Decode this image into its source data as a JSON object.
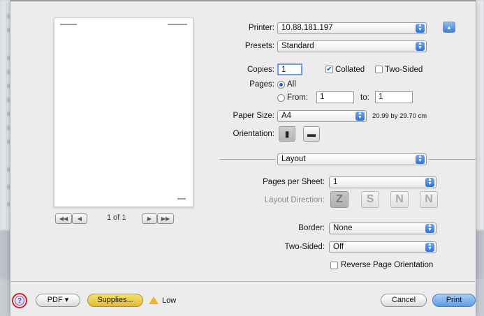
{
  "printer": {
    "label": "Printer:",
    "value": "10.88.181.197"
  },
  "presets": {
    "label": "Presets:",
    "value": "Standard"
  },
  "copies": {
    "label": "Copies:",
    "value": "1",
    "collated_label": "Collated",
    "collated_checked": true,
    "two_sided_label": "Two-Sided",
    "two_sided_checked": false
  },
  "pages": {
    "label": "Pages:",
    "all_label": "All",
    "from_label": "From:",
    "from_value": "1",
    "to_label": "to:",
    "to_value": "1"
  },
  "paper_size": {
    "label": "Paper Size:",
    "value": "A4",
    "dimensions": "20.99 by 29.70 cm"
  },
  "orientation": {
    "label": "Orientation:"
  },
  "section": {
    "value": "Layout"
  },
  "pages_per_sheet": {
    "label": "Pages per Sheet:",
    "value": "1"
  },
  "layout_direction": {
    "label": "Layout Direction:",
    "options": [
      "Z",
      "S",
      "N",
      "N"
    ]
  },
  "border": {
    "label": "Border:",
    "value": "None"
  },
  "two_sided": {
    "label": "Two-Sided:",
    "value": "Off"
  },
  "reverse": {
    "label": "Reverse Page Orientation",
    "checked": false
  },
  "preview": {
    "page_count": "1 of 1"
  },
  "footer": {
    "pdf": "PDF ▾",
    "supplies": "Supplies...",
    "low": "Low",
    "cancel": "Cancel",
    "print": "Print",
    "help": "?"
  },
  "colors": {
    "accent": "#3f7cd8",
    "highlight": "#d8232a",
    "warning": "#f0b42b"
  }
}
